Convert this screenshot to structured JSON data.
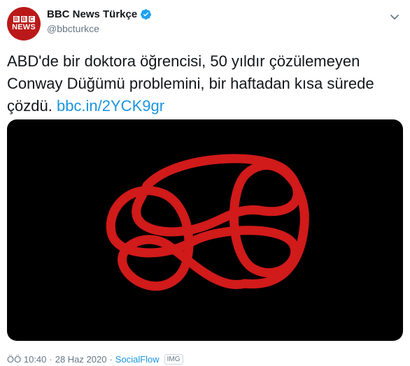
{
  "account": {
    "avatar_logo": "BBC",
    "avatar_logo_letters": [
      "B",
      "B",
      "C"
    ],
    "avatar_sub": "NEWS",
    "display_name": "BBC News Türkçe",
    "handle": "@bbcturkce",
    "verified_icon": "verified-badge-icon"
  },
  "tweet": {
    "text": "ABD'de bir doktora öğrencisi, 50 yıldır çözülemeyen Conway Düğümü problemini, bir haftadan kısa sürede çözdü.",
    "link": "bbc.in/2YCK9gr"
  },
  "media": {
    "description_icon": "knot-image",
    "knot_color": "#d11a1a",
    "background": "#000000"
  },
  "meta": {
    "time": "ÖÖ 10:40",
    "separator": "·",
    "date": "28 Haz 2020",
    "source": "SocialFlow",
    "badge": "IMG"
  },
  "colors": {
    "link": "#1b95e0",
    "brand": "#bb1919",
    "muted": "#657786"
  }
}
